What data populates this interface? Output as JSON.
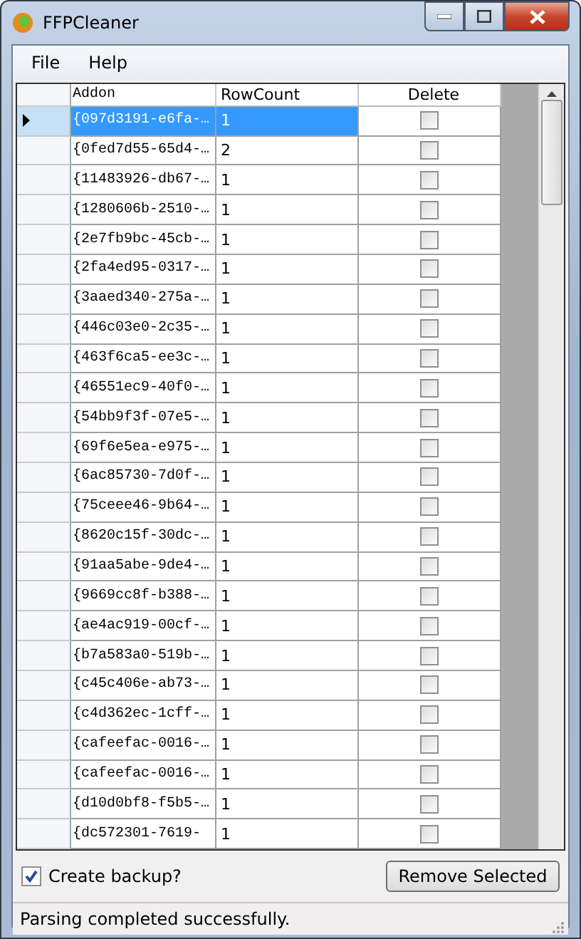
{
  "window": {
    "title": "FFPCleaner"
  },
  "menu": [
    "File",
    "Help"
  ],
  "table": {
    "columns": [
      "Addon",
      "RowCount",
      "Delete"
    ],
    "rows": [
      {
        "addon": "{097d3191-e6fa-…",
        "row_count": "1",
        "delete": false,
        "selected": true
      },
      {
        "addon": "{0fed7d55-65d4-…",
        "row_count": "2",
        "delete": false,
        "selected": false
      },
      {
        "addon": "{11483926-db67-…",
        "row_count": "1",
        "delete": false,
        "selected": false
      },
      {
        "addon": "{1280606b-2510-…",
        "row_count": "1",
        "delete": false,
        "selected": false
      },
      {
        "addon": "{2e7fb9bc-45cb-…",
        "row_count": "1",
        "delete": false,
        "selected": false
      },
      {
        "addon": "{2fa4ed95-0317-…",
        "row_count": "1",
        "delete": false,
        "selected": false
      },
      {
        "addon": "{3aaed340-275a-…",
        "row_count": "1",
        "delete": false,
        "selected": false
      },
      {
        "addon": "{446c03e0-2c35-…",
        "row_count": "1",
        "delete": false,
        "selected": false
      },
      {
        "addon": "{463f6ca5-ee3c-…",
        "row_count": "1",
        "delete": false,
        "selected": false
      },
      {
        "addon": "{46551ec9-40f0-…",
        "row_count": "1",
        "delete": false,
        "selected": false
      },
      {
        "addon": "{54bb9f3f-07e5-…",
        "row_count": "1",
        "delete": false,
        "selected": false
      },
      {
        "addon": "{69f6e5ea-e975-…",
        "row_count": "1",
        "delete": false,
        "selected": false
      },
      {
        "addon": "{6ac85730-7d0f-…",
        "row_count": "1",
        "delete": false,
        "selected": false
      },
      {
        "addon": "{75ceee46-9b64-…",
        "row_count": "1",
        "delete": false,
        "selected": false
      },
      {
        "addon": "{8620c15f-30dc-…",
        "row_count": "1",
        "delete": false,
        "selected": false
      },
      {
        "addon": "{91aa5abe-9de4-…",
        "row_count": "1",
        "delete": false,
        "selected": false
      },
      {
        "addon": "{9669cc8f-b388-…",
        "row_count": "1",
        "delete": false,
        "selected": false
      },
      {
        "addon": "{ae4ac919-00cf-…",
        "row_count": "1",
        "delete": false,
        "selected": false
      },
      {
        "addon": "{b7a583a0-519b-…",
        "row_count": "1",
        "delete": false,
        "selected": false
      },
      {
        "addon": "{c45c406e-ab73-…",
        "row_count": "1",
        "delete": false,
        "selected": false
      },
      {
        "addon": "{c4d362ec-1cff-…",
        "row_count": "1",
        "delete": false,
        "selected": false
      },
      {
        "addon": "{cafeefac-0016-…",
        "row_count": "1",
        "delete": false,
        "selected": false
      },
      {
        "addon": "{cafeefac-0016-…",
        "row_count": "1",
        "delete": false,
        "selected": false
      },
      {
        "addon": "{d10d0bf8-f5b5-…",
        "row_count": "1",
        "delete": false,
        "selected": false
      },
      {
        "addon": "{dc572301-7619-",
        "row_count": "1",
        "delete": false,
        "selected": false
      }
    ]
  },
  "backup": {
    "label": "Create backup?",
    "checked": true
  },
  "remove_button": "Remove Selected",
  "status_bar": "Parsing completed successfully."
}
